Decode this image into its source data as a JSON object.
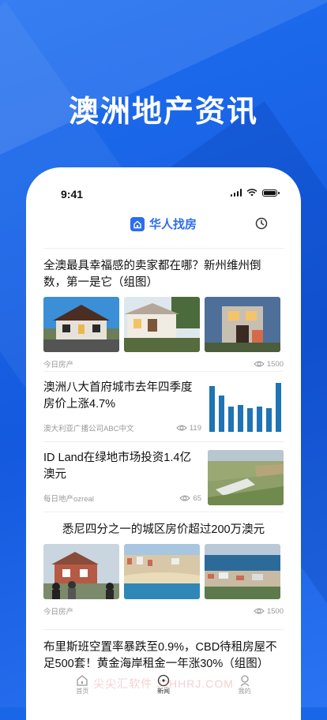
{
  "hero": {
    "title": "澳洲地产资讯"
  },
  "status": {
    "time": "9:41"
  },
  "app": {
    "brand": "华人找房"
  },
  "articles": [
    {
      "title": "全澳最具幸福感的卖家都在哪？新州维州倒数，第一是它（组图）",
      "source": "今日房产",
      "views": "1500"
    },
    {
      "title": "澳洲八大首府城市去年四季度房价上涨4.7%",
      "source": "澳大利亚广播公司ABC中文",
      "views": "119"
    },
    {
      "title": "ID Land在绿地市场投资1.4亿澳元",
      "source": "每日地产ozreal",
      "views": "65"
    },
    {
      "title": "悉尼四分之一的城区房价超过200万澳元",
      "source": "今日房产",
      "views": "1500"
    },
    {
      "title": "布里斯班空置率暴跌至0.9%，CBD待租房屋不足500套！黄金海岸租金一年涨30%（组图）"
    }
  ],
  "tabs": [
    {
      "label": "首页"
    },
    {
      "label": "新闻"
    },
    {
      "label": "我的"
    }
  ],
  "watermark": "尖尖汇软件 JJHHRJ.COM"
}
